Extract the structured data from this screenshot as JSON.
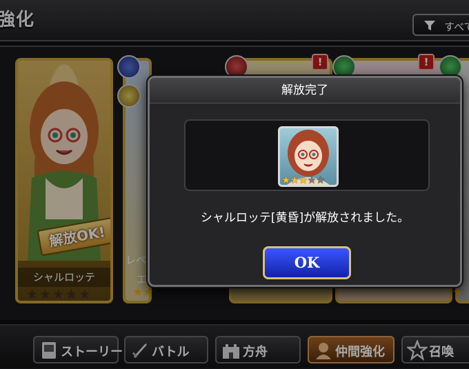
{
  "header": {
    "title": "強化",
    "filter_label": "すべて"
  },
  "cards": {
    "main": {
      "name": "シャルロッテ",
      "badge": "解放OK!",
      "stars_filled": 3,
      "stars_total": 5
    },
    "partial_level_label": "レベ",
    "partial_letter": "エ"
  },
  "dialog": {
    "title": "解放完了",
    "message": "シャルロッテ[黄昏]が解放されました。",
    "ok_label": "OK",
    "portrait_stars_filled": 3,
    "portrait_stars_total": 5
  },
  "alerts": [
    "!",
    "!"
  ],
  "nav": {
    "items": [
      {
        "label": "ストーリー",
        "icon": "book-icon"
      },
      {
        "label": "バトル",
        "icon": "sword-icon"
      },
      {
        "label": "方舟",
        "icon": "castle-icon"
      },
      {
        "label": "仲間強化",
        "icon": "ally-icon",
        "active": true
      },
      {
        "label": "召喚",
        "icon": "star-icon"
      }
    ]
  },
  "colors": {
    "accent_gold": "#c9a23a",
    "ok_button_blue": "#2a3fd6",
    "active_tab": "#a8622a"
  }
}
